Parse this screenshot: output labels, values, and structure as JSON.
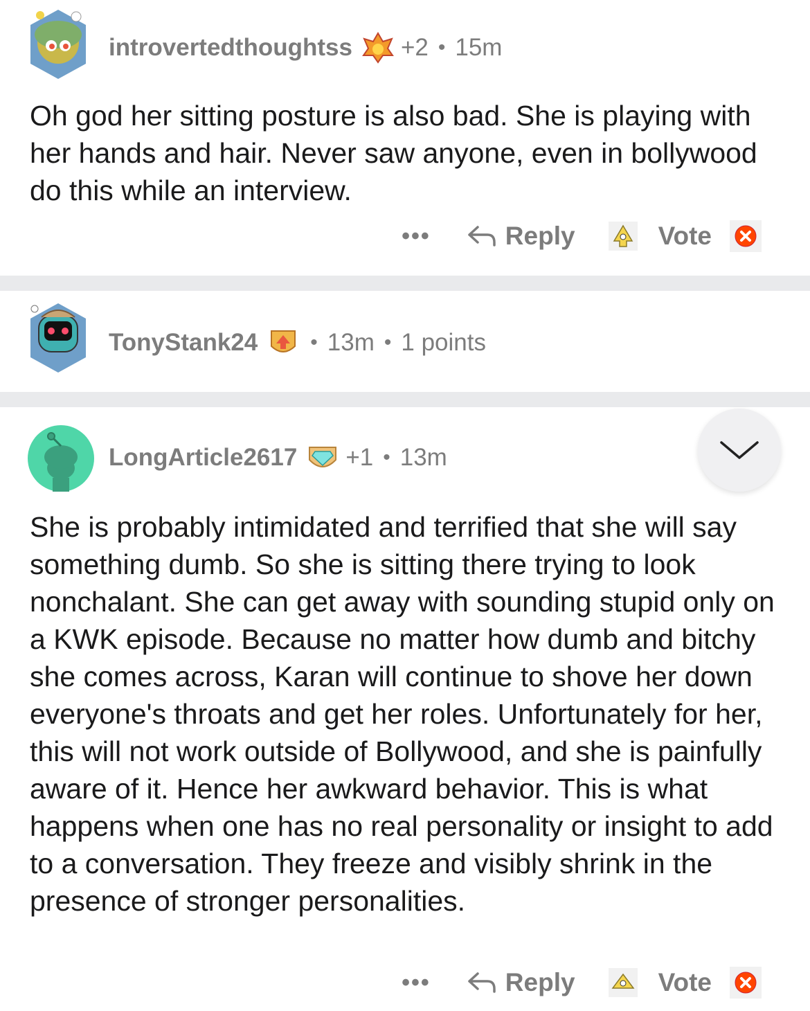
{
  "comments": [
    {
      "username": "introvertedthoughtss",
      "score": "+2",
      "time": "15m",
      "body": "Oh god her sitting posture is also bad. She is playing with her hands and hair. Never saw anyone, even in bollywood do this while an interview.",
      "more_label": "•••",
      "reply_label": "Reply",
      "vote_label": "Vote"
    },
    {
      "username": "TonyStank24",
      "time": "13m",
      "points": "1 points"
    },
    {
      "username": "LongArticle2617",
      "score": "+1",
      "time": "13m",
      "body": "She is probably intimidated and terrified that she will say something dumb. So she is sitting there trying to look nonchalant. She can get away with sounding stupid only on a KWK episode. Because no matter how dumb and bitchy she comes across, Karan will continue to shove her down everyone's throats and get her roles. Unfortunately for her, this will not work outside of Bollywood, and she is painfully aware of it. Hence her awkward behavior. This is what happens when one has no real personality or insight to add to a conversation. They freeze and visibly shrink in the presence of stronger personalities.",
      "more_label": "•••",
      "reply_label": "Reply",
      "vote_label": "Vote"
    }
  ],
  "separator": "•",
  "colors": {
    "divider": "#e9eaec",
    "meta": "#7c7c7c",
    "text": "#1a1a1b",
    "downvote": "#ff4500"
  },
  "icons": [
    "avatar-image",
    "award-icon",
    "reply-arrow-icon",
    "upvote-icon",
    "downvote-icon",
    "chevron-down-icon"
  ]
}
